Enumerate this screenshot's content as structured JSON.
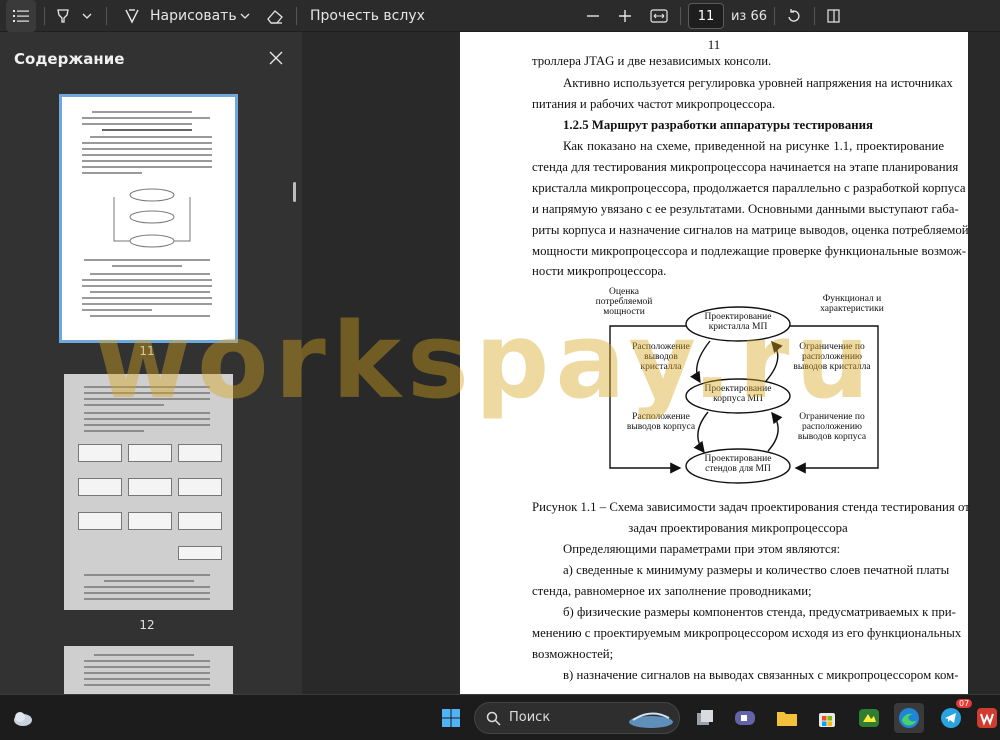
{
  "toolbar": {
    "draw_label": "Нарисовать",
    "read_aloud_label": "Прочесть вслух",
    "page_current": "11",
    "page_total": "из 66"
  },
  "sidebar": {
    "title": "Содержание",
    "thumbnails": [
      {
        "label": "11",
        "selected": true
      },
      {
        "label": "12",
        "selected": false
      }
    ]
  },
  "document": {
    "page_number": "11",
    "lines": [
      "троллера JTAG и две независимых консоли.",
      "Активно используется регулировка уровней напряжения на источниках",
      "питания и рабочих частот микропроцессора.",
      "1.2.5 Маршрут разработки аппаратуры тестирования",
      "Как показано на схеме, приведенной на рисунке 1.1, проектирование",
      "стенда для тестирования микропроцессора начинается на этапе планирования",
      "кристалла микропроцессора, продолжается параллельно с разработкой корпуса",
      "и напрямую увязано с ее результатами. Основными данными выступают габа-",
      "риты корпуса и назначение сигналов на матрице выводов, оценка потребляемой",
      "мощности микропроцессора и подлежащие проверке функциональные возмож-",
      "ности микропроцессора.",
      "Рисунок 1.1 – Схема зависимости задач проектирования стенда тестирования от",
      "задач проектирования микропроцессора",
      "Определяющими параметрами при этом являются:",
      "а) сведенные к минимуму размеры и количество слоев печатной платы",
      "стенда, равномерное их заполнение проводниками;",
      "б) физические размеры компонентов стенда, предусматриваемых к при-",
      "менению с проектируемым микропроцессором исходя из его функциональных",
      "возможностей;",
      "в) назначение сигналов на выводах связанных с микропроцессором ком-"
    ],
    "diagram": {
      "nodes": [
        "Проектирование кристалла МП",
        "Проектирование корпуса МП",
        "Проектирование стендов для МП"
      ],
      "labels": [
        "Оценка потребляемой мощности",
        "Функционал и характеристики",
        "Расположение выводов кристалла",
        "Ограничение по расположению выводов кристалла",
        "Расположение выводов корпуса",
        "Ограничение по расположению выводов корпуса"
      ]
    }
  },
  "watermark": "workspay.ru",
  "taskbar": {
    "search_label": "Поиск",
    "telegram_badge": "07"
  }
}
